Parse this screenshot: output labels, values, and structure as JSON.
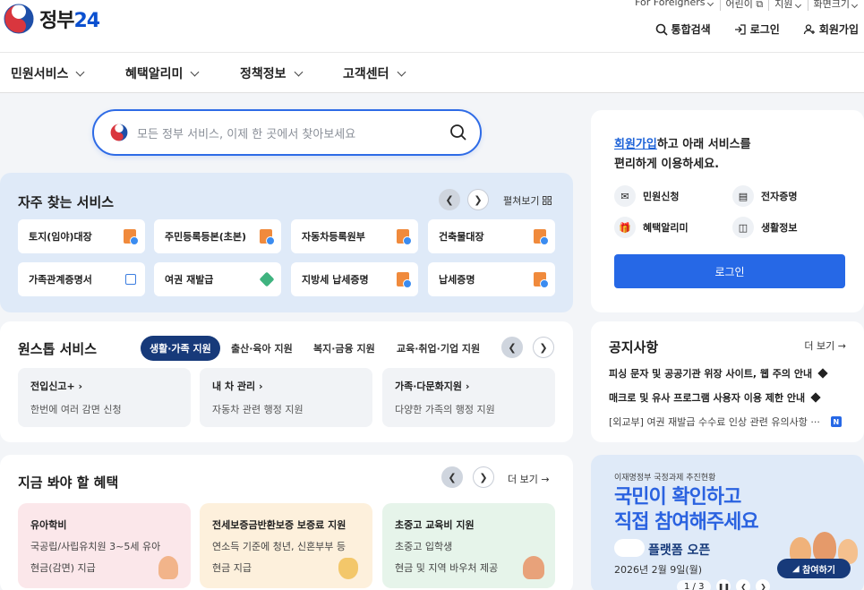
{
  "header": {
    "logo_text": "정부",
    "logo_num": "24",
    "util": [
      "For Foreigners",
      "어린이",
      "지원",
      "화면크기"
    ],
    "actions": [
      "통합검색",
      "로그인",
      "회원가입"
    ]
  },
  "gnb": [
    "민원서비스",
    "혜택알리미",
    "정책정보",
    "고객센터"
  ],
  "search": {
    "placeholder": "모든 정부 서비스, 이제 한 곳에서 찾아보세요"
  },
  "frequent": {
    "title": "자주 찾는 서비스",
    "expand": "펼쳐보기",
    "items": [
      "토지(임야)대장",
      "주민등록등본(초본)",
      "자동차등록원부",
      "건축물대장",
      "가족관계증명서",
      "여권 재발급",
      "지방세 납세증명",
      "납세증명"
    ]
  },
  "onestop": {
    "title": "원스톱 서비스",
    "tabs": [
      "생활·가족 지원",
      "출산·육아 지원",
      "복지·금융 지원",
      "교육·취업·기업 지원"
    ],
    "cards": [
      {
        "title": "전입신고+",
        "desc": "한번에 여러 감면 신청"
      },
      {
        "title": "내 차 관리",
        "desc": "자동차 관련 행정 지원"
      },
      {
        "title": "가족·다문화지원",
        "desc": "다양한 가족의 행정 지원"
      }
    ]
  },
  "benefits": {
    "title": "지금 봐야 할 혜택",
    "more": "더 보기",
    "cards": [
      {
        "title": "유아학비",
        "line1": "국공립/사립유치원 3~5세 유아",
        "line2": "현금(감면) 지급"
      },
      {
        "title": "전세보증금반환보증 보증료 지원",
        "line1": "연소득 기준에 청년, 신혼부부 등",
        "line2": "현금 지급"
      },
      {
        "title": "초중고 교육비 지원",
        "line1": "초중고 입학생",
        "line2": "현금 및 지역 바우처 제공"
      }
    ]
  },
  "login": {
    "link": "회원가입",
    "msg1": "하고 아래 서비스를",
    "msg2": "편리하게 이용하세요.",
    "quick": [
      "민원신청",
      "전자증명",
      "혜택알리미",
      "생활정보"
    ],
    "button": "로그인"
  },
  "notice": {
    "title": "공지사항",
    "more": "더 보기",
    "items": [
      "피싱 문자 및 공공기관 위장 사이트, 웹 주의 안내",
      "매크로 및 유사 프로그램 사용자 이용 제한 안내",
      "[외교부] 여권 재발급 수수료 인상 관련 유의사항 ···"
    ],
    "badge": "N"
  },
  "banner": {
    "kicker": "이재명정부 국정과제 추진현황",
    "headline1": "국민이 확인하고",
    "headline2": "직접 참여해주세요",
    "platform": "플랫폼 오픈",
    "date": "2026년 2월 9일(월)",
    "join": "참여하기",
    "page": "1 / 3"
  },
  "colors": {
    "primary": "#2668e6",
    "navy": "#173a7a",
    "search_border": "#2e6be6"
  }
}
